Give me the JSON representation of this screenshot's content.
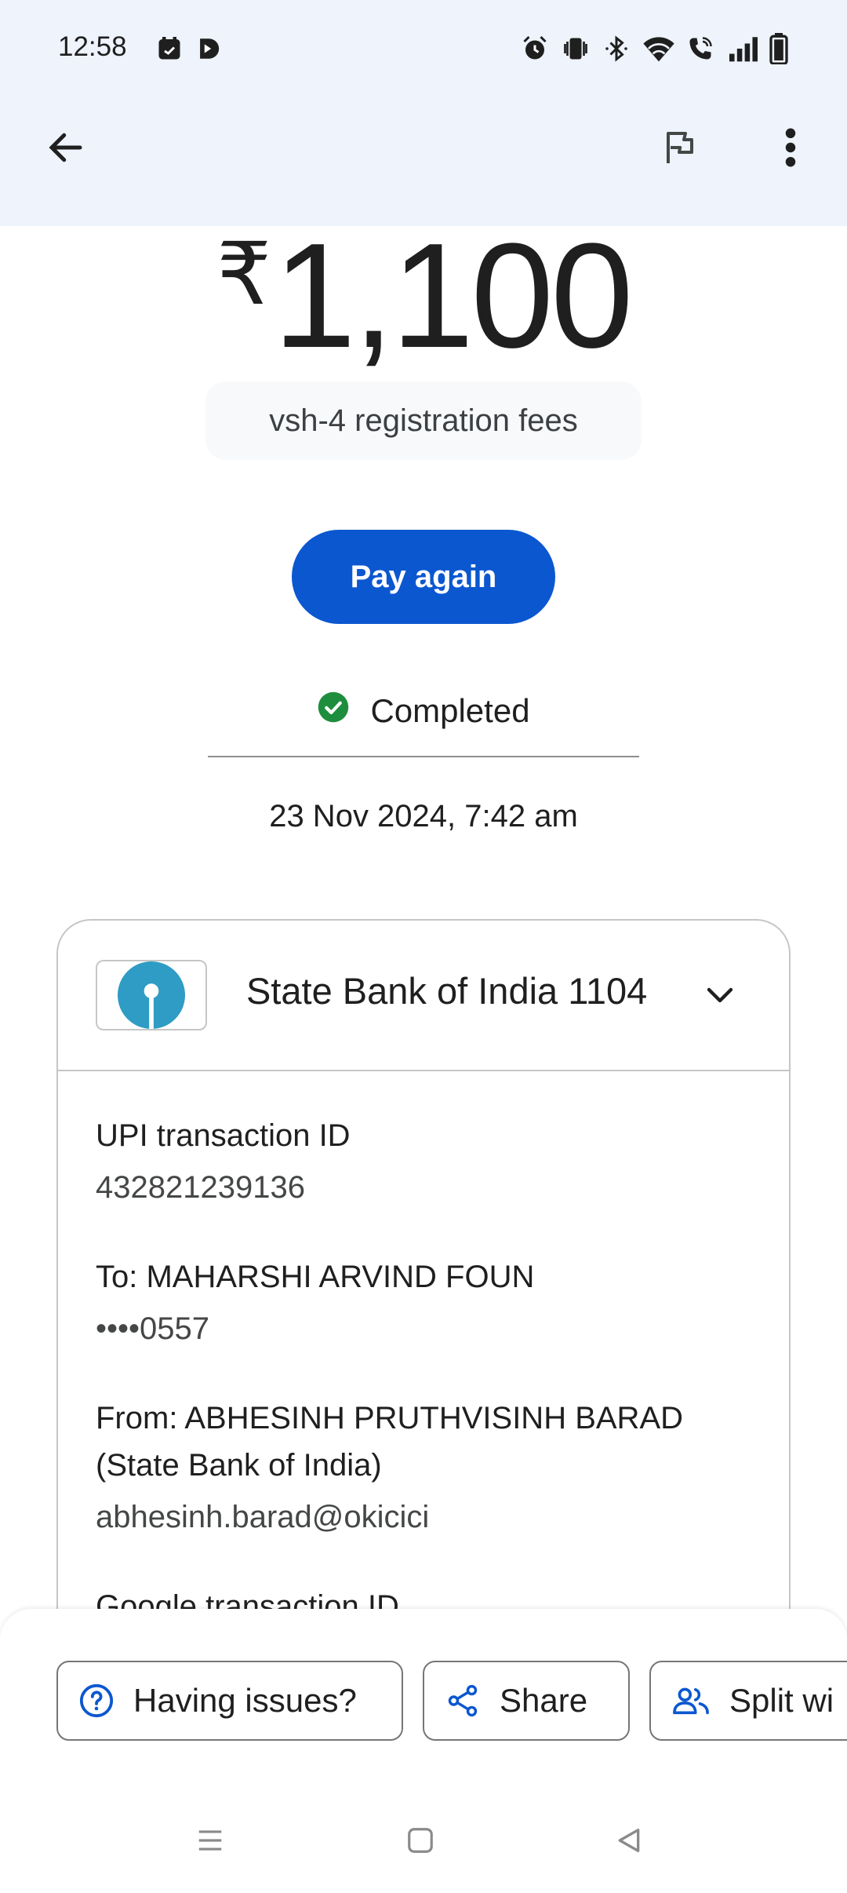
{
  "status_bar": {
    "time": "12:58",
    "icons": [
      "calendar-app-icon",
      "play-icon",
      "alarm-icon",
      "vibrate-icon",
      "bluetooth-icon",
      "wifi-icon",
      "wifi-calling-icon",
      "signal-icon",
      "battery-icon"
    ]
  },
  "toolbar": {
    "back_icon": "arrow-back-icon",
    "flag_icon": "flag-icon",
    "more_icon": "more-vert-icon"
  },
  "transaction": {
    "currency_symbol": "₹",
    "amount": "1,100",
    "note": "vsh-4 registration fees",
    "pay_again_label": "Pay again",
    "status": "Completed",
    "status_color": "#1e8e3e",
    "datetime": "23 Nov 2024, 7:42 am"
  },
  "details_card": {
    "bank_name": "State Bank of India 1104",
    "bank_color": "#2e9cc4",
    "fields": [
      {
        "label": "UPI transaction ID",
        "value": "432821239136"
      },
      {
        "label": "To: MAHARSHI ARVIND FOUN",
        "value": "••••0557"
      },
      {
        "label": "From: ABHESINH PRUTHVISINH BARAD (State Bank of India)",
        "value": "abhesinh.barad@okicici"
      },
      {
        "label": "Google transaction ID",
        "value": ""
      }
    ]
  },
  "actions": {
    "having_issues_label": "Having issues?",
    "share_label": "Share",
    "split_label": "Split wi",
    "accent_color": "#0b57d0"
  },
  "nav": {
    "icons": [
      "recents-icon",
      "home-icon",
      "back-icon"
    ]
  }
}
